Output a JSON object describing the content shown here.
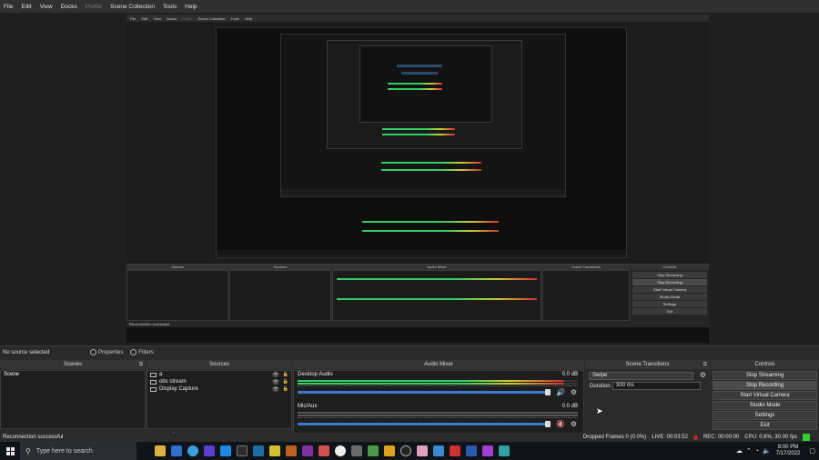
{
  "menu": {
    "items": [
      "File",
      "Edit",
      "View",
      "Docks",
      "Profile",
      "Scene Collection",
      "Tools",
      "Help"
    ]
  },
  "source_bar": {
    "no_source": "No source selected",
    "properties": "Properties",
    "filters": "Filters"
  },
  "scenes": {
    "title": "Scenes",
    "items": [
      "Scene"
    ],
    "footer": [
      "+",
      "−",
      "∧",
      "∨"
    ]
  },
  "sources": {
    "title": "Sources",
    "items": [
      "a",
      "obs stream",
      "Display Capture"
    ],
    "footer": [
      "+",
      "−",
      "⚙",
      "∧",
      "∨"
    ]
  },
  "mixer": {
    "title": "Audio Mixer",
    "channels": [
      {
        "name": "Desktop Audio",
        "db": "0.0 dB",
        "muted": false,
        "level": 0.95
      },
      {
        "name": "Mic/Aux",
        "db": "0.0 dB",
        "muted": true,
        "level": 0.95
      }
    ]
  },
  "transitions": {
    "title": "Scene Transitions",
    "selected": "Swipe",
    "duration_label": "Duration",
    "duration_value": "300 ms"
  },
  "controls": {
    "title": "Controls",
    "buttons": [
      "Stop Streaming",
      "Stop Recording",
      "Start Virtual Camera",
      "Studio Mode",
      "Settings",
      "Exit"
    ]
  },
  "status": {
    "message": "Reconnection successful",
    "dropped": "Dropped Frames 0 (0.0%)",
    "live": "LIVE: 00:03:52",
    "rec": "REC: 00:00:00",
    "cpu": "CPU: 0.6%, 30.00 fps"
  },
  "taskbar": {
    "search_placeholder": "Type here to search",
    "time": "8:00 PM",
    "date": "7/17/2022"
  },
  "colors": {
    "accent": "#3a7ad0",
    "meter_green": "#33cc66",
    "meter_yellow": "#cccc33",
    "meter_red": "#cc3333",
    "muted": "#e03030",
    "status_ok": "#2fd02f"
  }
}
